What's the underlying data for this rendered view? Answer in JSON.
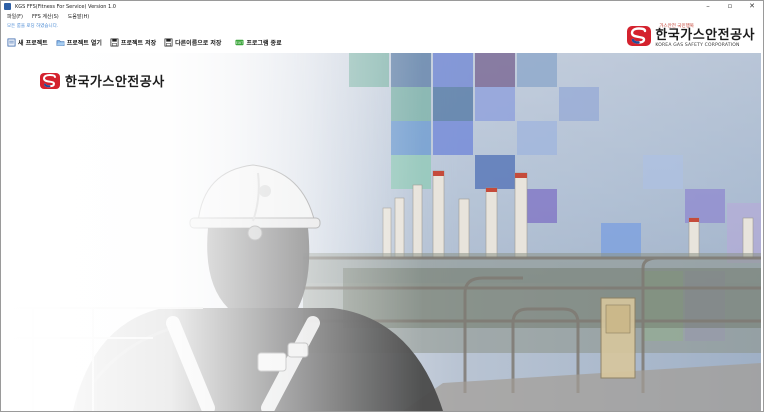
{
  "window": {
    "title": "KGS FFS(Fitness For Service) Version 1.0",
    "controls": [
      "–",
      "▫",
      "✕"
    ]
  },
  "menu": [
    "파일(F)",
    "FFS 계산(S)",
    "도움말(H)"
  ],
  "hint": "모든 룸을 로딩 하였습니다.",
  "toolbar": [
    {
      "label": "새 프로젝트",
      "icon": "new-project-icon"
    },
    {
      "label": "프로젝트 열기",
      "icon": "open-project-icon"
    },
    {
      "label": "프로젝트 저장",
      "icon": "save-project-icon"
    },
    {
      "label": "다른이름으로 저장",
      "icon": "save-as-icon"
    },
    {
      "label": "프로그램 종료",
      "icon": "exit-icon"
    }
  ],
  "logo_top": {
    "slogan": "가스안전 국민행복",
    "name": "한국가스안전공사",
    "english": "KOREA GAS SAFETY CORPORATION"
  },
  "logo_hero": {
    "name": "한국가스안전공사"
  },
  "colors": {
    "brand_red": "#d4222e",
    "brand_blue": "#1f4c9a",
    "hint_blue": "#4a8ad4"
  }
}
